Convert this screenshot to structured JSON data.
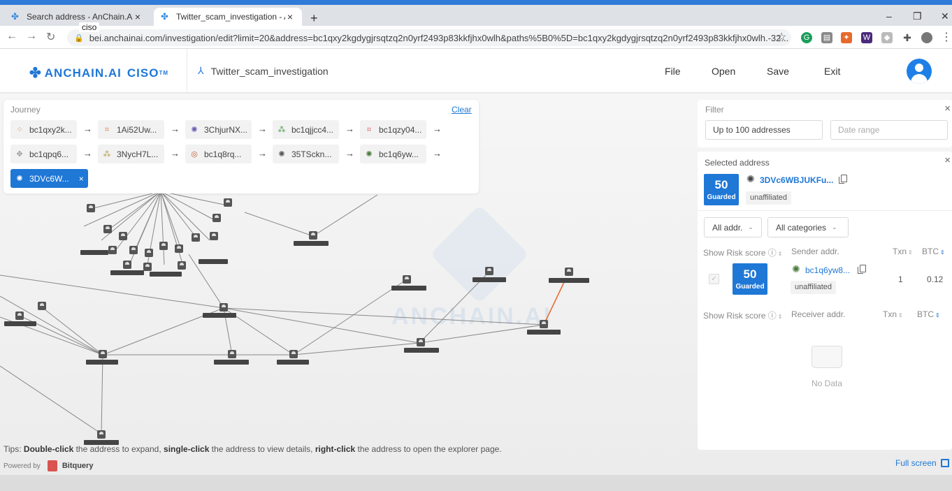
{
  "browser": {
    "tabs": [
      {
        "title": "Search address - AnChain.AI",
        "close": "×"
      },
      {
        "title": "Twitter_scam_investigation - AnC",
        "close": "×"
      }
    ],
    "new_tab": "+",
    "tooltip": "ciso",
    "url": "bei.anchainai.com/investigation/edit?limit=20&address=bc1qxy2kgdygjrsqtzq2n0yrf2493p83kkfjhx0wlh&paths%5B0%5D=bc1qxy2kgdygjrsqtzq2n0yrf2493p83kkfjhx0wlh.-32...",
    "window_controls": {
      "minimize": "–",
      "maximize": "❐",
      "close": "✕"
    }
  },
  "app": {
    "brand": "ANCHAIN.AI",
    "product": "CISO",
    "tm": "TM",
    "project_title": "Twitter_scam_investigation",
    "menu": [
      "File",
      "Open",
      "Save",
      "Exit"
    ]
  },
  "journey": {
    "title": "Journey",
    "clear": "Clear",
    "arrow": "→",
    "chips": [
      {
        "label": "bc1qxy2k...",
        "icon": "⁘",
        "color": "#e07b39"
      },
      {
        "label": "1Ai52Uw...",
        "icon": "⌗",
        "color": "#e07b39"
      },
      {
        "label": "3ChjurNX...",
        "icon": "✺",
        "color": "#6b5bb5"
      },
      {
        "label": "bc1qjjcc4...",
        "icon": "⁂",
        "color": "#4a9a4a"
      },
      {
        "label": "bc1qzy04...",
        "icon": "⌗",
        "color": "#d9534f"
      },
      {
        "label": "bc1qpq6...",
        "icon": "✥",
        "color": "#999"
      },
      {
        "label": "3NycH7L...",
        "icon": "⁂",
        "color": "#b5a04a"
      },
      {
        "label": "bc1q8rq...",
        "icon": "◎",
        "color": "#c0603a"
      },
      {
        "label": "35TSckn...",
        "icon": "✺",
        "color": "#555"
      },
      {
        "label": "bc1q6yw...",
        "icon": "✺",
        "color": "#4a7a3a"
      }
    ],
    "selected_chip": {
      "label": "3DVc6W...",
      "icon": "✺",
      "remove": "×"
    }
  },
  "filter": {
    "title": "Filter",
    "close": "×",
    "addresses_value": "Up to 100 addresses",
    "date_placeholder": "Date range"
  },
  "selected_address": {
    "title": "Selected address",
    "close": "×",
    "score": "50",
    "score_label": "Guarded",
    "address": "3DVc6WBJUKFu...",
    "tag": "unaffiliated",
    "addr_filter": "All addr.",
    "category_filter": "All categories",
    "sender_headers": {
      "risk": "Show Risk score",
      "addr": "Sender addr.",
      "txn": "Txn",
      "btc": "BTC"
    },
    "sender_rows": [
      {
        "score": "50",
        "score_label": "Guarded",
        "address": "bc1q6yw8...",
        "tag": "unaffiliated",
        "txn": "1",
        "btc": "0.12"
      }
    ],
    "receiver_headers": {
      "risk": "Show Risk score",
      "addr": "Receiver addr.",
      "txn": "Txn",
      "btc": "BTC"
    },
    "no_data": "No Data"
  },
  "footer": {
    "tips_prefix": "Tips: ",
    "tip1_bold": "Double-click",
    "tip1_rest": " the address to expand, ",
    "tip2_bold": "single-click",
    "tip2_rest": " the address to view details, ",
    "tip3_bold": "right-click",
    "tip3_rest": " the address to open the explorer page.",
    "powered_by": "Powered by",
    "provider": "Bitquery",
    "full_screen": "Full screen"
  },
  "watermark": "ANCHAIN.AI",
  "colors": {
    "accent": "#1f77d6",
    "chrome": "#2f7bd8"
  }
}
